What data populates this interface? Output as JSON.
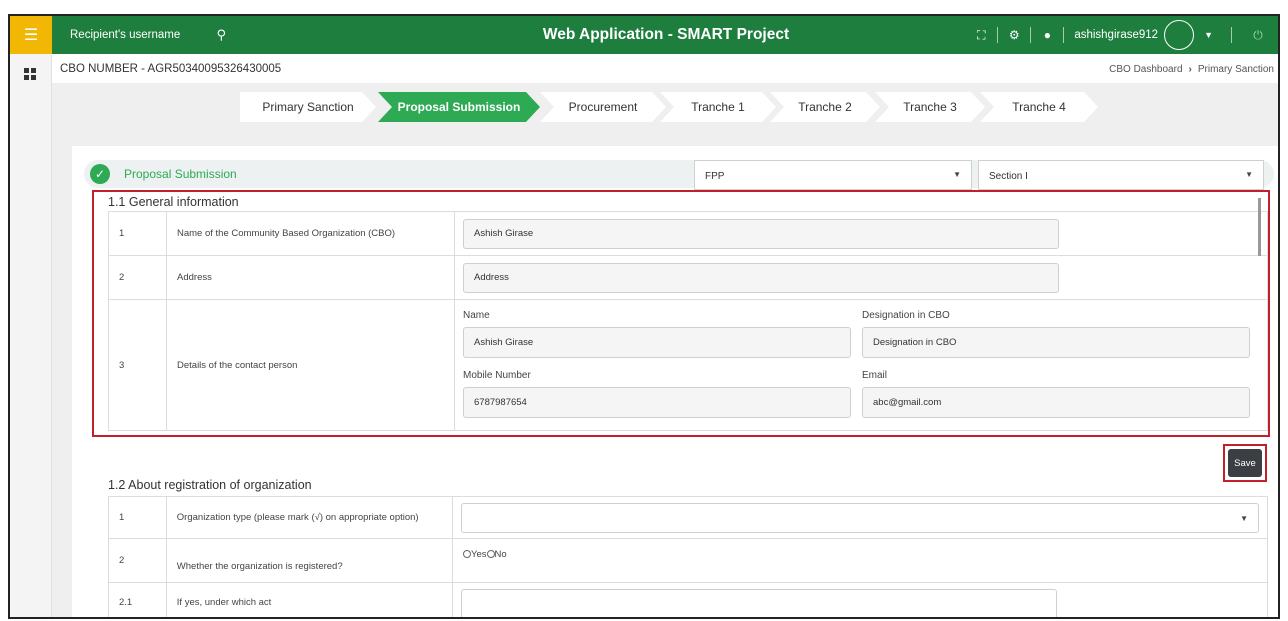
{
  "topbar": {
    "search_placeholder": "Recipient's username",
    "title": "Web Application - SMART Project",
    "username": "ashishgirase912"
  },
  "subheader": {
    "cbo_number": "CBO NUMBER - AGR50340095326430005",
    "breadcrumb": [
      "CBO Dashboard",
      "Primary Sanction"
    ]
  },
  "steps": [
    {
      "label": "Primary Sanction",
      "active": false
    },
    {
      "label": "Proposal Submission",
      "active": true
    },
    {
      "label": "Procurement",
      "active": false
    },
    {
      "label": "Tranche 1",
      "active": false
    },
    {
      "label": "Tranche 2",
      "active": false
    },
    {
      "label": "Tranche 3",
      "active": false
    },
    {
      "label": "Tranche 4",
      "active": false
    }
  ],
  "section": {
    "title": "Proposal Submission",
    "fpp_value": "FPP",
    "section_value": "Section I"
  },
  "general": {
    "heading": "1.1 General information",
    "rows": [
      {
        "no": "1",
        "label": "Name of the Community Based Organization (CBO)",
        "value": "Ashish Girase"
      },
      {
        "no": "2",
        "label": "Address",
        "value": "Address"
      },
      {
        "no": "3",
        "label": "Details of the contact person"
      }
    ],
    "contact": {
      "name_label": "Name",
      "name_value": "Ashish Girase",
      "designation_label": "Designation in CBO",
      "designation_value": "Designation in CBO",
      "mobile_label": "Mobile Number",
      "mobile_value": "6787987654",
      "email_label": "Email",
      "email_value": "abc@gmail.com"
    }
  },
  "save_label": "Save",
  "registration": {
    "heading": "1.2 About registration of organization",
    "rows": [
      {
        "no": "1",
        "label": "Organization type (please mark (√) on appropriate option)"
      },
      {
        "no": "2",
        "label": "Whether the organization is registered?"
      },
      {
        "no": "2.1",
        "label": "If yes, under which act"
      }
    ],
    "radio_yes": "Yes",
    "radio_no": "No"
  },
  "colors": {
    "topbar_green": "#1e7e3e",
    "accent_green": "#2daa53",
    "menu_yellow": "#f2b705",
    "highlight_red": "#c0202a"
  }
}
